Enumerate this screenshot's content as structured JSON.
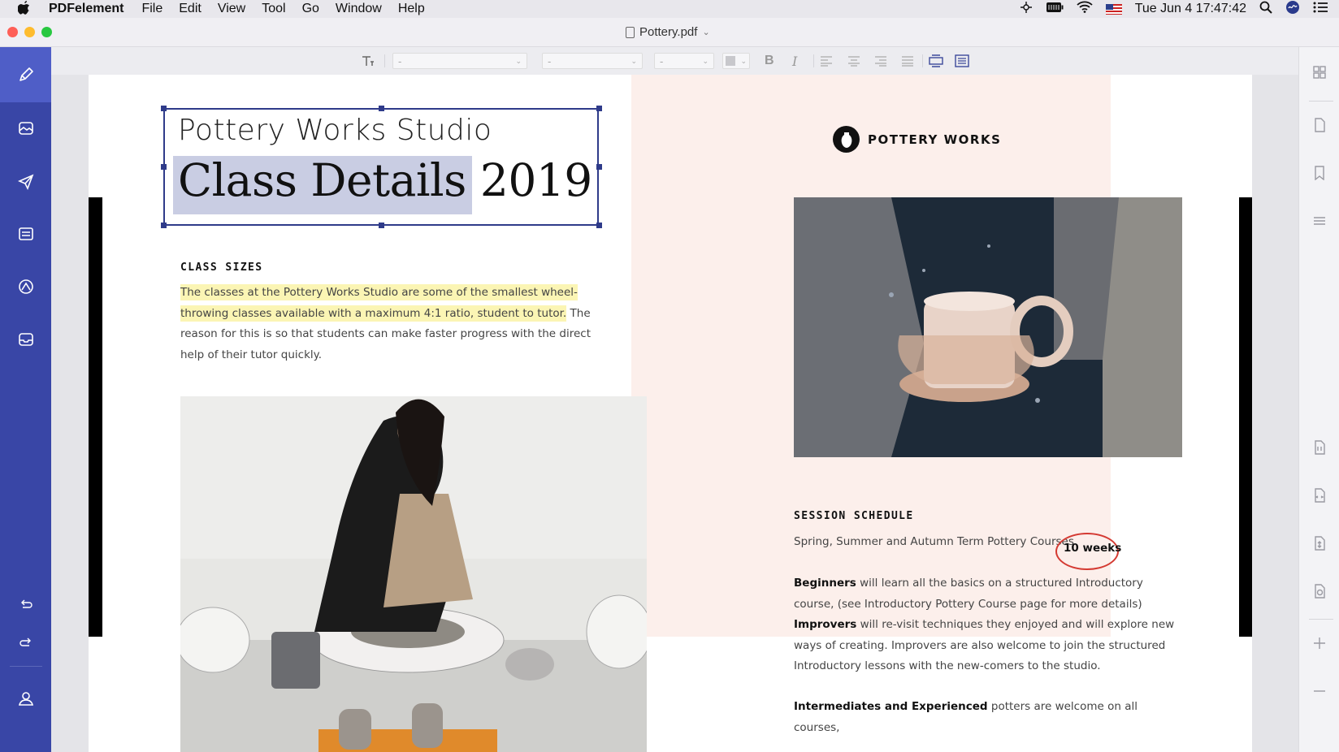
{
  "menubar": {
    "apple": "",
    "app_name": "PDFelement",
    "items": [
      "File",
      "Edit",
      "View",
      "Tool",
      "Go",
      "Window",
      "Help"
    ],
    "clock": "Tue Jun 4  17:47:42"
  },
  "window": {
    "title": "Pottery.pdf"
  },
  "sidebar": {
    "tools": [
      "edit-tool",
      "image-tool",
      "send-tool",
      "form-tool",
      "sign-tool",
      "inbox-tool"
    ],
    "bottom": [
      "undo",
      "redo",
      "account"
    ]
  },
  "toolbar": {
    "font_family": "-",
    "font_style": "-",
    "font_size": "-",
    "bold": "B",
    "italic": "I"
  },
  "document": {
    "studio_title": "Pottery Works Studio",
    "class_title_highlighted": "Class Details",
    "class_title_year": "2019",
    "class_sizes_heading": "CLASS SIZES",
    "class_sizes_highlighted_1": "The classes at the Pottery Works Studio are some of the smallest wheel-",
    "class_sizes_highlighted_2": "throwing classes available with a maximum 4:1 ratio, student to tutor.",
    "class_sizes_rest_1": " The",
    "class_sizes_rest_2": "reason for this is so that students can make faster progress with the direct",
    "class_sizes_rest_3": "help of their tutor quickly.",
    "logo_name": "POTTERY WORKS",
    "session_heading": "SESSION SCHEDULE",
    "session_line": "Spring, Summer and Autumn Term Pottery Courses",
    "session_weeks": "10 weeks",
    "beginners_label": "Beginners",
    "beginners_text_1": " will learn all the basics on a structured Introductory",
    "beginners_text_2": "course, (see Introductory Pottery Course page for more details)",
    "improvers_label": "Improvers",
    "improvers_text_1": " will re-visit techniques they enjoyed and will explore new",
    "improvers_text_2": "ways of creating. Improvers are also welcome to join the structured",
    "improvers_text_3": "Introductory lessons with the new-comers to the studio.",
    "intermediates_label": "Intermediates and Experienced",
    "intermediates_text_1": " potters are welcome on all courses,"
  },
  "colors": {
    "sidebar": "#3946a6",
    "sidebar_active": "#4f5ec7",
    "pink_panel": "#fcefeb",
    "highlight_yellow": "#fbf5b4",
    "selection_blue": "#c9cde3",
    "weeks_circle": "#d43a32"
  }
}
